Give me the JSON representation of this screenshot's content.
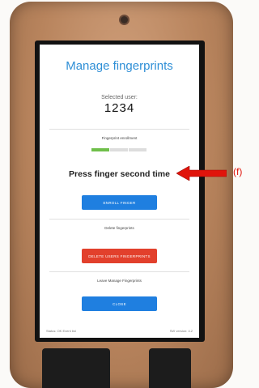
{
  "screen": {
    "title": "Manage fingerprints",
    "selected_user_label": "Selected user:",
    "selected_user_value": "1234",
    "enrollment_label": "Fingerprint enrollment",
    "enrollment_progress_fraction": 0.33,
    "status_message": "Press finger second time",
    "enroll_button_label": "ENROLL FINGER",
    "delete_section_label": "Delete fingerprints",
    "delete_button_label": "DELETE USERS FINGERPRINTS",
    "leave_section_label": "Leave Manage Fingerprints",
    "close_button_label": "CLOSE",
    "footer_left": "Status: OK Event list",
    "footer_right": "SW version: 4.2"
  },
  "annotation": {
    "label": "(f)",
    "color": "#e0140b"
  },
  "colors": {
    "title": "#2f8fd6",
    "primary_button": "#1f7fe0",
    "danger_button": "#e2402c",
    "progress": "#6fbf4a"
  }
}
